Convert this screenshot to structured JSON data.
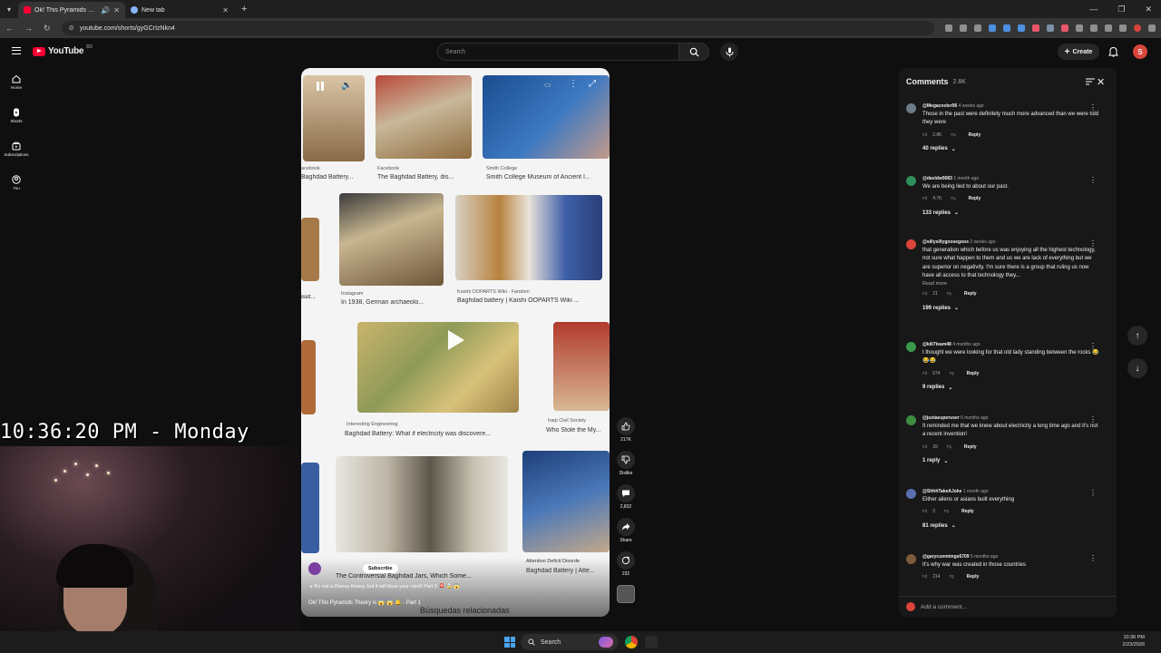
{
  "browser": {
    "tabs": [
      {
        "title": "Ok! This Pyramids Theory is",
        "active": true
      },
      {
        "title": "New tab",
        "active": false
      }
    ],
    "url": "youtube.com/shorts/gyGCrIzNkn4"
  },
  "header": {
    "logo_text": "YouTube",
    "logo_badge": "BD",
    "search_placeholder": "Search",
    "create_label": "Create",
    "avatar_letter": "S"
  },
  "guide": [
    {
      "label": "Home",
      "icon": "home-icon"
    },
    {
      "label": "Shorts",
      "icon": "shorts-icon"
    },
    {
      "label": "Subscriptions",
      "icon": "subscriptions-icon"
    },
    {
      "label": "You",
      "icon": "you-icon"
    }
  ],
  "video": {
    "grid_captions": [
      {
        "src": "acebook",
        "caption": "Baghdad Battery..."
      },
      {
        "src": "Facebook",
        "caption": "The Baghdad Battery, dis..."
      },
      {
        "src": "Smith College",
        "caption": "Smith College Museum of Ancient I..."
      },
      {
        "src": "ble",
        "caption": "Batt..."
      },
      {
        "src": "Instagram",
        "caption": "In 1938, German archaeolo..."
      },
      {
        "src": "Kaishi OOPARTS Wiki - Fandom",
        "caption": "Baghdad battery | Kaishi OOPARTS Wiki ..."
      },
      {
        "src": "Interesting Engineering",
        "caption": "Baghdad Battery: What if electricity was discovere..."
      },
      {
        "src": "Iraqi Civil Society",
        "caption": "Who Stole the My..."
      },
      {
        "src": "",
        "caption": "The Controversial Baghdad Jars, Which Some..."
      },
      {
        "src": "Attention Deficit Disorde",
        "caption": "Baghdad Battery | Atte..."
      }
    ],
    "related_label": "Búsquedas relacionadas",
    "channel_name": "",
    "subscribe_label": "Subscribe",
    "description": "It's not a Disney theory, but it will blow your mind! Part 5",
    "title": "Ok! This Pyramids Theory is",
    "title_suffix": "Part 1"
  },
  "actions": {
    "like_count": "217K",
    "dislike_label": "Dislike",
    "comment_count": "2,832",
    "share_label": "Share",
    "remix_count": "232"
  },
  "comments": {
    "title": "Comments",
    "count": "2.8K",
    "add_placeholder": "Add a comment...",
    "items": [
      {
        "user": "@Megacooler96",
        "time": "4 weeks ago",
        "text": "Those in the past were definitely much more advanced than we were told they were",
        "likes": "2.8K",
        "replies": "40 replies",
        "avatar_color": "#6d7b86"
      },
      {
        "user": "@davidw9083",
        "time": "1 month ago",
        "text": "We are being lied to about our past.",
        "likes": "4.7K",
        "replies": "133 replies",
        "avatar_color": "#2f8f5a"
      },
      {
        "user": "@sillysillygoosegoos",
        "time": "2 weeks ago",
        "text": "that generation which before us was enjoying all the highest technology, not sure what happen to them and us we are lack of everything but we are superior on negativity. I'm sure there is a group that ruling us now have all access to that technology they...",
        "more": "Read more",
        "likes": "21",
        "replies": "199 replies",
        "avatar_color": "#d9453a"
      },
      {
        "user": "@kill7team48",
        "time": "4 months ago",
        "text": "I thought we were looking for that old lady standing between the rocks 😂😂😂",
        "likes": "674",
        "replies": "9 replies",
        "avatar_color": "#3a9a4a"
      },
      {
        "user": "@justasuperuser",
        "time": "6 months ago",
        "text": "It reminded me that we knew about electricity a long time ago and it's not a recent invention!",
        "likes": "39",
        "replies": "1 reply",
        "avatar_color": "#3c8d3f"
      },
      {
        "user": "@ShhhTakeAJoke",
        "time": "1 month ago",
        "text": "Either aliens or asians built everything",
        "likes": "3",
        "replies": "81 replies",
        "avatar_color": "#5a6fb0"
      },
      {
        "user": "@garycummings6709",
        "time": "5 months ago",
        "text": "It's why war was created in those countries",
        "likes": "214",
        "replies": "",
        "avatar_color": "#7c5a3e"
      }
    ],
    "reply_label": "Reply"
  },
  "overlay": {
    "clock_text": "10:36:20 PM - Monday"
  },
  "taskbar": {
    "search_label": "Search",
    "time": "10:36 PM",
    "date": "2/23/2026"
  }
}
